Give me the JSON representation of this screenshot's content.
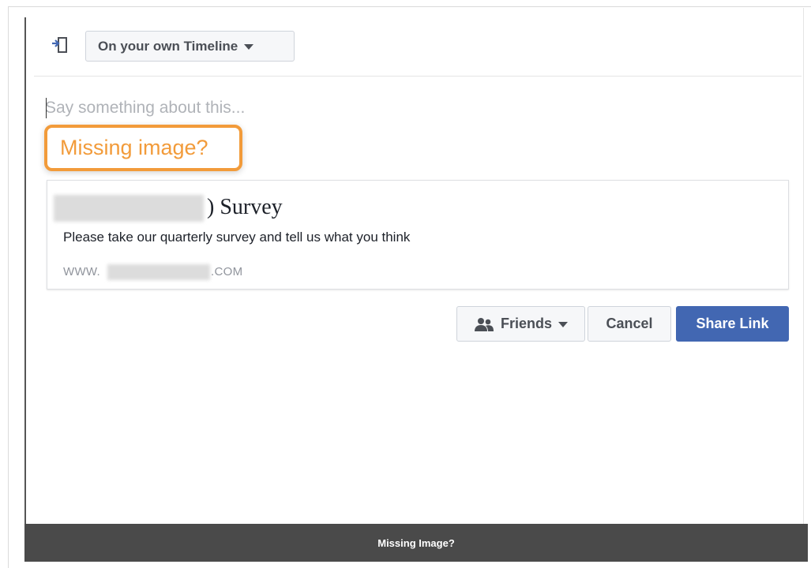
{
  "header": {
    "audience_label": "On your own Timeline"
  },
  "composer": {
    "placeholder": "Say something about this..."
  },
  "callout": {
    "text": "Missing image?"
  },
  "link_card": {
    "title_visible": ") Survey",
    "description": "Please take our quarterly survey and tell us what you think",
    "url_prefix": "WWW.",
    "url_suffix": ".COM"
  },
  "actions": {
    "privacy_label": "Friends",
    "cancel_label": "Cancel",
    "share_label": "Share Link"
  },
  "footer": {
    "caption": "Missing Image?"
  },
  "colors": {
    "accent": "#4267b2",
    "callout": "#f29b3a",
    "footer_bg": "#4a4a4a"
  },
  "icons": {
    "share": "share-to-timeline-icon",
    "friends": "friends-icon"
  }
}
